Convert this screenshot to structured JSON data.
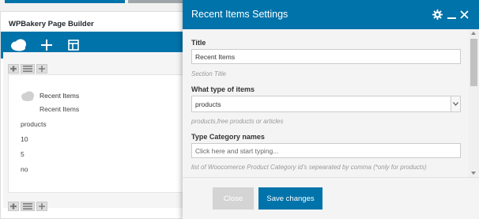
{
  "builder": {
    "title": "WPBakery Page Builder",
    "element": {
      "name": "Recent Items",
      "subtitle": "Recent Items",
      "values": [
        "products",
        "10",
        "5",
        "no"
      ]
    }
  },
  "modal": {
    "title": "Recent Items Settings",
    "fields": {
      "title": {
        "label": "Title",
        "value": "Recent Items",
        "help": "Section Title"
      },
      "type": {
        "label": "What type of items",
        "value": "products",
        "help": "products,free products or articles"
      },
      "category": {
        "label": "Type Category names",
        "placeholder": "Click here and start typing...",
        "help": "list of Woocomerce Product Category id's sepearated by comma (*only for products)"
      }
    },
    "buttons": {
      "close": "Close",
      "save": "Save changes"
    }
  },
  "colors": {
    "accent": "#0073aa",
    "button_disabled": "#d4d4d4"
  },
  "icons": {
    "builder_logo": "cloud-icon",
    "add": "plus-icon",
    "templates": "template-icon",
    "settings": "gear-icon",
    "minimize": "minimize-icon",
    "close": "close-icon"
  }
}
